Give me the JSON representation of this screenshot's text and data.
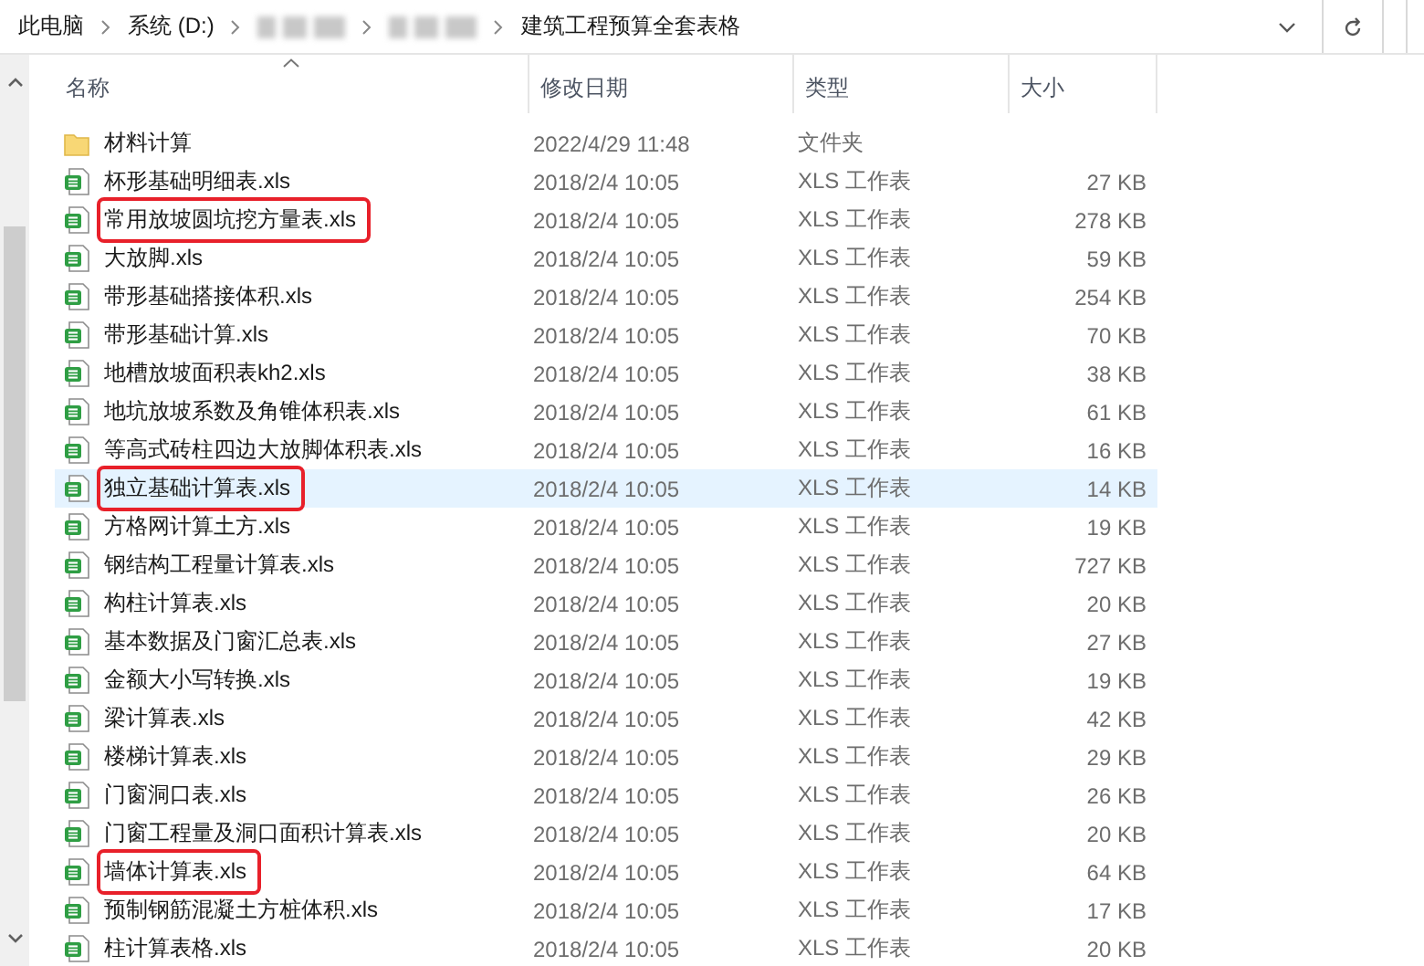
{
  "address_bar": {
    "breadcrumb": [
      {
        "kind": "text",
        "label": "此电脑"
      },
      {
        "kind": "text",
        "label": "系统 (D:)"
      },
      {
        "kind": "redacted"
      },
      {
        "kind": "redacted"
      },
      {
        "kind": "text",
        "label": "建筑工程预算全套表格"
      }
    ]
  },
  "columns": [
    {
      "label": "名称",
      "sorted": true
    },
    {
      "label": "修改日期",
      "sorted": false
    },
    {
      "label": "类型",
      "sorted": false
    },
    {
      "label": "大小",
      "sorted": false
    }
  ],
  "rows": [
    {
      "kind": "folder",
      "name": "材料计算",
      "modified": "2022/4/29 11:48",
      "type": "文件夹",
      "selected": false,
      "marked": false
    },
    {
      "kind": "xls",
      "name": "杯形基础明细表.xls",
      "modified": "2018/2/4 10:05",
      "type": "XLS 工作表",
      "size": "27 KB",
      "selected": false,
      "marked": false
    },
    {
      "kind": "xls",
      "name": "常用放坡圆坑挖方量表.xls",
      "modified": "2018/2/4 10:05",
      "type": "XLS 工作表",
      "size": "278 KB",
      "selected": false,
      "marked": true
    },
    {
      "kind": "xls",
      "name": "大放脚.xls",
      "modified": "2018/2/4 10:05",
      "type": "XLS 工作表",
      "size": "59 KB",
      "selected": false,
      "marked": false
    },
    {
      "kind": "xls",
      "name": "带形基础搭接体积.xls",
      "modified": "2018/2/4 10:05",
      "type": "XLS 工作表",
      "size": "254 KB",
      "selected": false,
      "marked": false
    },
    {
      "kind": "xls",
      "name": "带形基础计算.xls",
      "modified": "2018/2/4 10:05",
      "type": "XLS 工作表",
      "size": "70 KB",
      "selected": false,
      "marked": false
    },
    {
      "kind": "xls",
      "name": "地槽放坡面积表kh2.xls",
      "modified": "2018/2/4 10:05",
      "type": "XLS 工作表",
      "size": "38 KB",
      "selected": false,
      "marked": false
    },
    {
      "kind": "xls",
      "name": "地坑放坡系数及角锥体积表.xls",
      "modified": "2018/2/4 10:05",
      "type": "XLS 工作表",
      "size": "61 KB",
      "selected": false,
      "marked": false
    },
    {
      "kind": "xls",
      "name": "等高式砖柱四边大放脚体积表.xls",
      "modified": "2018/2/4 10:05",
      "type": "XLS 工作表",
      "size": "16 KB",
      "selected": false,
      "marked": false
    },
    {
      "kind": "xls",
      "name": "独立基础计算表.xls",
      "modified": "2018/2/4 10:05",
      "type": "XLS 工作表",
      "size": "14 KB",
      "selected": true,
      "marked": true
    },
    {
      "kind": "xls",
      "name": "方格网计算土方.xls",
      "modified": "2018/2/4 10:05",
      "type": "XLS 工作表",
      "size": "19 KB",
      "selected": false,
      "marked": false
    },
    {
      "kind": "xls",
      "name": "钢结构工程量计算表.xls",
      "modified": "2018/2/4 10:05",
      "type": "XLS 工作表",
      "size": "727 KB",
      "selected": false,
      "marked": false
    },
    {
      "kind": "xls",
      "name": "构柱计算表.xls",
      "modified": "2018/2/4 10:05",
      "type": "XLS 工作表",
      "size": "20 KB",
      "selected": false,
      "marked": false
    },
    {
      "kind": "xls",
      "name": "基本数据及门窗汇总表.xls",
      "modified": "2018/2/4 10:05",
      "type": "XLS 工作表",
      "size": "27 KB",
      "selected": false,
      "marked": false
    },
    {
      "kind": "xls",
      "name": "金额大小写转换.xls",
      "modified": "2018/2/4 10:05",
      "type": "XLS 工作表",
      "size": "19 KB",
      "selected": false,
      "marked": false
    },
    {
      "kind": "xls",
      "name": "梁计算表.xls",
      "modified": "2018/2/4 10:05",
      "type": "XLS 工作表",
      "size": "42 KB",
      "selected": false,
      "marked": false
    },
    {
      "kind": "xls",
      "name": "楼梯计算表.xls",
      "modified": "2018/2/4 10:05",
      "type": "XLS 工作表",
      "size": "29 KB",
      "selected": false,
      "marked": false
    },
    {
      "kind": "xls",
      "name": "门窗洞口表.xls",
      "modified": "2018/2/4 10:05",
      "type": "XLS 工作表",
      "size": "26 KB",
      "selected": false,
      "marked": false
    },
    {
      "kind": "xls",
      "name": "门窗工程量及洞口面积计算表.xls",
      "modified": "2018/2/4 10:05",
      "type": "XLS 工作表",
      "size": "20 KB",
      "selected": false,
      "marked": false
    },
    {
      "kind": "xls",
      "name": "墙体计算表.xls",
      "modified": "2018/2/4 10:05",
      "type": "XLS 工作表",
      "size": "64 KB",
      "selected": false,
      "marked": true
    },
    {
      "kind": "xls",
      "name": "预制钢筋混凝土方桩体积.xls",
      "modified": "2018/2/4 10:05",
      "type": "XLS 工作表",
      "size": "17 KB",
      "selected": false,
      "marked": false
    },
    {
      "kind": "xls",
      "name": "柱计算表格.xls",
      "modified": "2018/2/4 10:05",
      "type": "XLS 工作表",
      "size": "20 KB",
      "selected": false,
      "marked": false
    }
  ]
}
